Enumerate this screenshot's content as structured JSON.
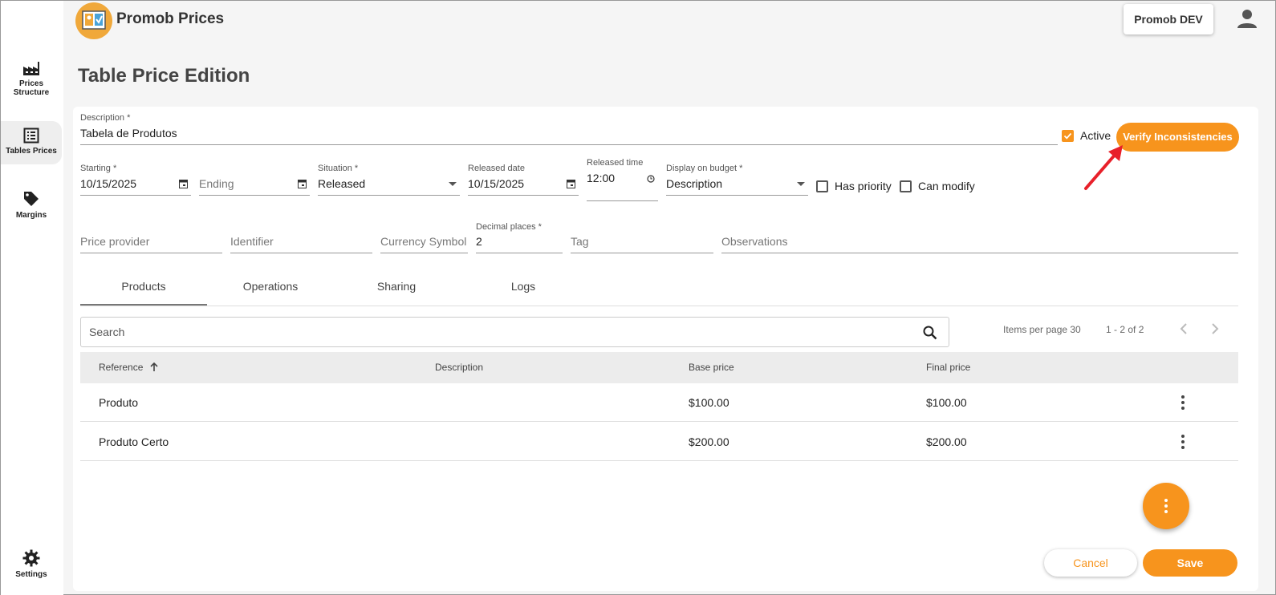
{
  "header": {
    "app_title": "Promob Prices",
    "environment_label": "Promob DEV"
  },
  "sidebar": {
    "items": [
      {
        "label": "Prices Structure",
        "icon": "factory-icon"
      },
      {
        "label": "Tables Prices",
        "icon": "list-icon"
      },
      {
        "label": "Margins",
        "icon": "tag-icon"
      },
      {
        "label": "Settings",
        "icon": "gear-icon"
      }
    ]
  },
  "page": {
    "title": "Table Price Edition"
  },
  "form": {
    "description_label": "Description *",
    "description_value": "Tabela de Produtos",
    "active_label": "Active",
    "verify_label": "Verify Inconsistencies",
    "starting_label": "Starting *",
    "starting_value": "10/15/2025",
    "ending_placeholder": "Ending",
    "situation_label": "Situation *",
    "situation_value": "Released",
    "released_date_label": "Released date",
    "released_date_value": "10/15/2025",
    "released_time_label": "Released time",
    "released_time_value": "12:00",
    "display_budget_label": "Display on budget *",
    "display_budget_value": "Description",
    "has_priority_label": "Has priority",
    "can_modify_label": "Can modify",
    "price_provider_placeholder": "Price provider",
    "identifier_placeholder": "Identifier",
    "currency_symbol_placeholder": "Currency Symbol",
    "decimal_places_label": "Decimal places *",
    "decimal_places_value": "2",
    "tag_placeholder": "Tag",
    "observations_placeholder": "Observations"
  },
  "tabs": [
    "Products",
    "Operations",
    "Sharing",
    "Logs"
  ],
  "search": {
    "placeholder": "Search"
  },
  "pager": {
    "items_per_page": "Items per page 30",
    "range": "1 - 2 of 2"
  },
  "table": {
    "columns": [
      "Reference",
      "Description",
      "Base price",
      "Final price"
    ],
    "rows": [
      {
        "reference": "Produto",
        "description": "",
        "base_price": "$100.00",
        "final_price": "$100.00"
      },
      {
        "reference": "Produto Certo",
        "description": "",
        "base_price": "$200.00",
        "final_price": "$200.00"
      }
    ]
  },
  "actions": {
    "cancel_label": "Cancel",
    "save_label": "Save"
  },
  "colors": {
    "accent": "#f7941d",
    "annotation_arrow": "#e8202a"
  }
}
